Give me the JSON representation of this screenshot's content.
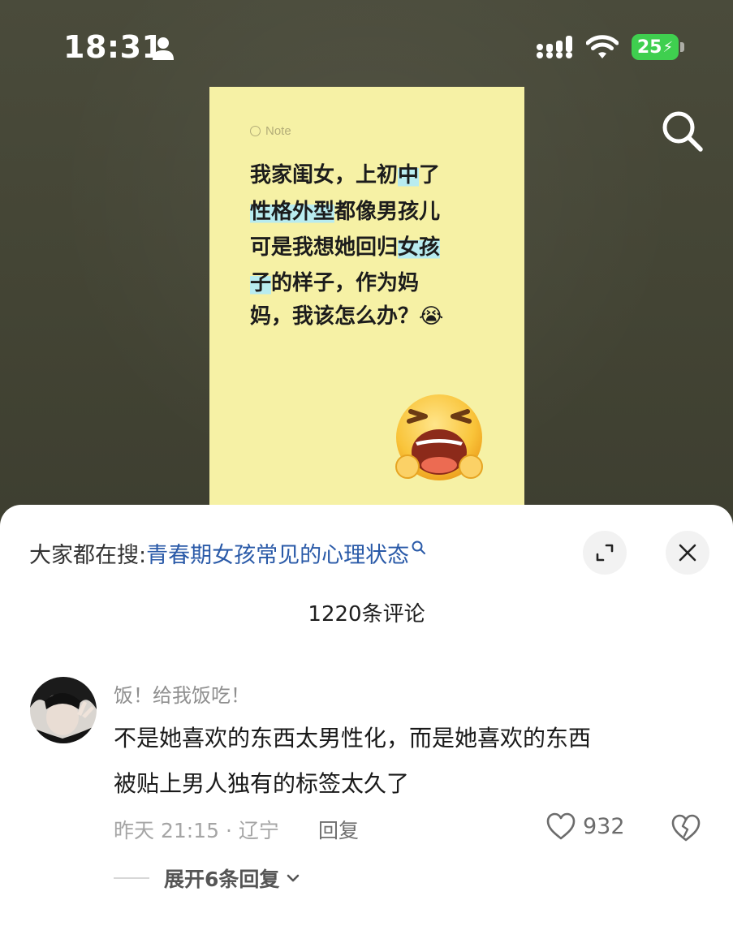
{
  "status_bar": {
    "time": "18:31",
    "battery": "25",
    "icons": [
      "person-icon",
      "signal-icon",
      "wifi-icon",
      "battery-charging-icon"
    ]
  },
  "video": {
    "search_icon": "search-icon"
  },
  "note": {
    "tag": "Note",
    "lines": [
      {
        "before": "我家闺女，上初",
        "highlight": "中",
        "after": "了"
      },
      {
        "before": "",
        "highlight": "性格外型",
        "after": "都像男孩儿"
      },
      {
        "before": "可是我想她回归",
        "highlight": "女孩",
        "after": ""
      },
      {
        "before": "",
        "highlight": "子",
        "after": "的样子，作为妈"
      },
      {
        "before": "妈，我该怎么办？😭",
        "highlight": "",
        "after": ""
      }
    ],
    "emoji": "crying-face-emoji"
  },
  "sheet": {
    "trending_prefix": "大家都在搜:",
    "trending_query": "青春期女孩常见的心理状态",
    "expand_icon": "expand-icon",
    "close_icon": "close-icon",
    "comment_count": "1220条评论"
  },
  "comment": {
    "username": "饭！给我饭吃！",
    "text_line1": "不是她喜欢的东西太男性化，而是她喜欢的东西",
    "text_line2": "被贴上男人独有的标签太久了",
    "meta": "昨天 21:15 · 辽宁",
    "reply_label": "回复",
    "likes": "932",
    "expand_replies": "展开6条回复"
  },
  "colors": {
    "note_bg": "#f6f1a5",
    "highlight": "#b8ecf0",
    "link": "#2a5aa8",
    "battery": "#3fcf4f"
  }
}
